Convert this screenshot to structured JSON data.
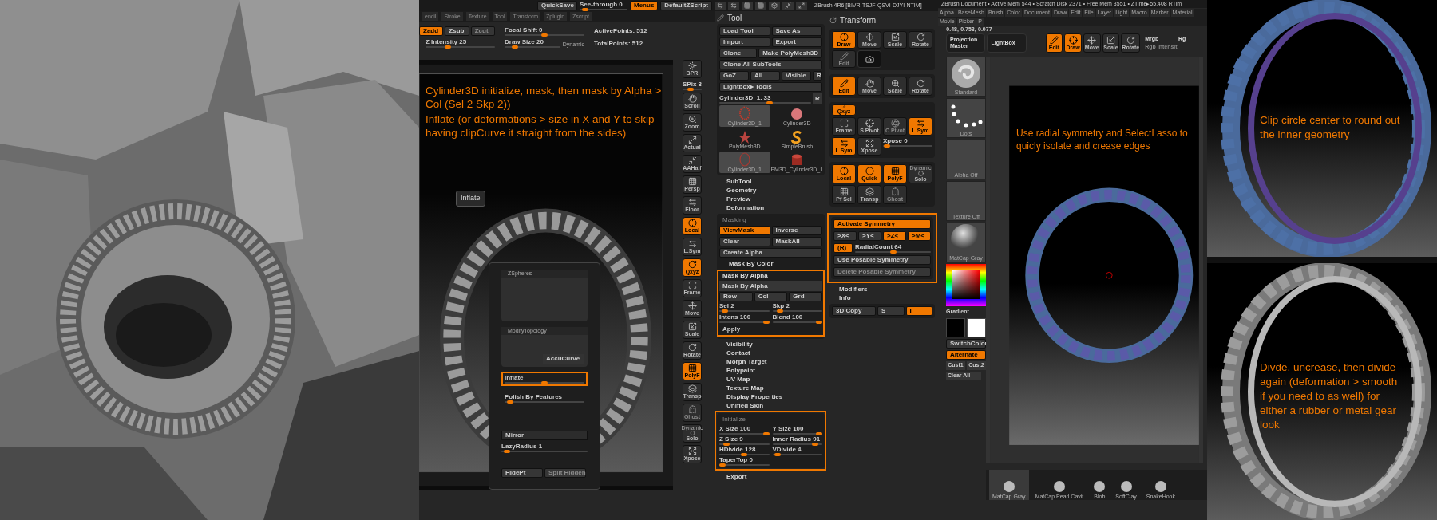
{
  "viewport": {
    "top_buttons": [
      {
        "label": "QuickSave",
        "on": false
      },
      {
        "label": "Menus",
        "on": true
      },
      {
        "label": "DefaultZScript",
        "on": false
      }
    ],
    "see_through": {
      "label": "See-through  0",
      "level": 0.05
    },
    "app_title": "ZBrush 4R6 [BIVR-TSJF-QSVI-DJYI-NTIM]",
    "menu": [
      "encil",
      "Stroke",
      "Texture",
      "Tool",
      "Transform",
      "Zplugin",
      "Zscript"
    ],
    "modes": [
      {
        "label": "Zadd",
        "on": true,
        "disabled": false
      },
      {
        "label": "Zsub",
        "on": false,
        "disabled": false
      },
      {
        "label": "Zcut",
        "on": false,
        "disabled": true
      }
    ],
    "sliders": [
      {
        "label": "Z Intensity 25",
        "level": 0.3
      },
      {
        "label": "Focal Shift 0",
        "level": 0.5
      },
      {
        "label": "Draw Size 20",
        "level": 0.15
      }
    ],
    "dynamic": "Dynamic",
    "stats": [
      "ActivePoints: 512",
      "TotalPoints: 512"
    ],
    "annotation": [
      "Cylinder3D initialize, mask, then mask by Alpha > Col (Sel 2 Skp 2))",
      "Inflate (or deformations  > size in X and Y to skip having clipCurve it straight from the sides)"
    ],
    "popup": {
      "sections": [
        "ZSpheres",
        "ModifyTopology"
      ],
      "accucurve": "AccuCurve",
      "sliders": [
        {
          "label": "Inflate",
          "level": 0.5,
          "highlighted": true
        },
        {
          "label": "Polish By Features",
          "level": 0.03,
          "highlighted": false
        }
      ],
      "mirror": "Mirror",
      "lazy": {
        "label": "LazyRadius 1",
        "level": 0.03
      },
      "buttons": [
        {
          "label": "HidePt",
          "disabled": false
        },
        {
          "label": "Split Hidden",
          "disabled": true
        }
      ]
    },
    "tooltip": "Inflate",
    "shelf": [
      {
        "kind": "button",
        "label": "BPR",
        "on": false,
        "disabled": false
      },
      {
        "kind": "slider",
        "label": "SPix 3",
        "level": 0.4
      },
      {
        "kind": "button",
        "label": "Scroll",
        "on": false,
        "disabled": false
      },
      {
        "kind": "button",
        "label": "Zoom",
        "on": false,
        "disabled": false
      },
      {
        "kind": "button",
        "label": "Actual",
        "on": false,
        "disabled": false
      },
      {
        "kind": "button",
        "label": "AAHalf",
        "on": false,
        "disabled": false
      },
      {
        "kind": "button",
        "label": "Persp",
        "on": false,
        "disabled": false
      },
      {
        "kind": "button",
        "label": "Floor",
        "on": false,
        "disabled": false
      },
      {
        "kind": "button",
        "label": "Local",
        "on": true,
        "disabled": false
      },
      {
        "kind": "button",
        "label": "L.Sym",
        "on": false,
        "disabled": false
      },
      {
        "kind": "button",
        "label": "Qxyz",
        "on": true,
        "disabled": false
      },
      {
        "kind": "button",
        "label": "Frame",
        "on": false,
        "disabled": false
      },
      {
        "kind": "button",
        "label": "Move",
        "on": false,
        "disabled": false
      },
      {
        "kind": "button",
        "label": "Scale",
        "on": false,
        "disabled": false
      },
      {
        "kind": "button",
        "label": "Rotate",
        "on": false,
        "disabled": false
      },
      {
        "kind": "button",
        "label": "PolyF",
        "on": true,
        "disabled": false
      },
      {
        "kind": "button",
        "label": "Transp",
        "on": false,
        "disabled": false
      },
      {
        "kind": "button",
        "label": "Ghost",
        "on": false,
        "disabled": true
      },
      {
        "kind": "button",
        "label": "Solo",
        "caption": "Dynamic",
        "on": false,
        "disabled": false
      },
      {
        "kind": "button",
        "label": "Xpose",
        "on": false,
        "disabled": false
      }
    ]
  },
  "tool_palette": {
    "title": "Tool",
    "rows": [
      [
        {
          "label": "Load Tool",
          "on": false
        },
        {
          "label": "Save As",
          "on": false
        }
      ],
      [
        {
          "label": "Import",
          "on": false
        },
        {
          "label": "Export",
          "on": false
        }
      ],
      [
        {
          "label": "Clone",
          "on": false
        },
        {
          "label": "Make PolyMesh3D",
          "on": false
        }
      ],
      [
        {
          "label": "Clone  All  SubTools",
          "on": false
        }
      ],
      [
        {
          "label": "GoZ",
          "on": false
        },
        {
          "label": "All",
          "on": false
        },
        {
          "label": "Visible",
          "on": false
        },
        {
          "label": "R",
          "on": false
        }
      ],
      [
        {
          "label": "Lightbox▸ Tools",
          "on": false
        }
      ]
    ],
    "current": {
      "label": "Cylinder3D_1. 33",
      "level": 0.55,
      "button": "R"
    },
    "thumbnails": [
      {
        "label": "Cylinder3D_1",
        "selected": true
      },
      {
        "label": "Cylinder3D",
        "selected": false
      },
      {
        "label": "PolyMesh3D",
        "selected": false
      },
      {
        "label": "SimpleBrush",
        "selected": false
      },
      {
        "label": "Cylinder3D_1",
        "selected": true
      },
      {
        "label": "PM3D_Cylinder3D_1",
        "selected": false
      }
    ],
    "sections_top": [
      "SubTool",
      "Geometry",
      "Preview",
      "Deformation"
    ],
    "masking": {
      "title": "Masking",
      "rows": [
        [
          {
            "label": "ViewMask",
            "on": true
          },
          {
            "label": "Inverse",
            "on": false
          }
        ],
        [
          {
            "label": "Clear",
            "on": false
          },
          {
            "label": "MaskAll",
            "on": false
          }
        ],
        [
          {
            "label": "Create Alpha",
            "on": false
          }
        ]
      ],
      "mask_by_color": "Mask By Color",
      "mask_by_alpha": {
        "title": "Mask By Alpha",
        "highlighted": true,
        "button": "Mask By Alpha",
        "modes": [
          {
            "label": "Row",
            "on": false
          },
          {
            "label": "Col",
            "on": false
          },
          {
            "label": "Grd",
            "on": false
          }
        ],
        "sliders": [
          {
            "label": "Sel 2",
            "level": 0.05
          },
          {
            "label": "Skp 2",
            "level": 0.1
          },
          {
            "label": "Intens 100",
            "level": 1
          },
          {
            "label": "Blend 100",
            "level": 1
          }
        ],
        "apply": "Apply"
      }
    },
    "sections_mid": [
      "Visibility",
      "Contact",
      "Morph Target",
      "Polypaint",
      "UV Map",
      "Texture Map",
      "Display Properties",
      "Unified Skin"
    ],
    "initialize": {
      "title": "Initialize",
      "highlighted": true,
      "sliders": [
        {
          "label": "X Size 100",
          "level": 1
        },
        {
          "label": "Y Size 100",
          "level": 1
        },
        {
          "label": "Z Size 9",
          "level": 0.09
        },
        {
          "label": "Inner Radius 91",
          "level": 0.91
        },
        {
          "label": "HDivide 128",
          "level": 0.5
        },
        {
          "label": "VDivide 4",
          "level": 0.05
        },
        {
          "label": "TaperTop 0",
          "level": 0
        }
      ]
    },
    "sections_bottom": [
      "Export"
    ]
  },
  "transform_palette": {
    "title": "Transform",
    "group1": [
      {
        "label": "Draw",
        "on": true,
        "disabled": false
      },
      {
        "label": "Move",
        "on": false,
        "disabled": false
      },
      {
        "label": "Scale",
        "on": false,
        "disabled": false
      },
      {
        "label": "Rotate",
        "on": false,
        "disabled": false
      },
      {
        "label": "Edit",
        "on": false,
        "disabled": true
      }
    ],
    "group2": [
      {
        "label": "Edit",
        "on": true
      },
      {
        "label": "Move",
        "on": false
      },
      {
        "label": "Scale",
        "on": false
      },
      {
        "label": "Rotate",
        "on": false
      }
    ],
    "group3": [
      {
        "label": "Qxyz",
        "on": true,
        "disabled": false
      },
      {
        "label": "Frame",
        "on": false,
        "disabled": false
      },
      {
        "label": "S.Pivot",
        "on": false,
        "disabled": false
      },
      {
        "label": "C.Pivot",
        "on": false,
        "disabled": true
      },
      {
        "label": "L.Sym",
        "on": true,
        "disabled": false
      },
      {
        "label": "L.Sym",
        "on": true,
        "disabled": false
      },
      {
        "label": "Xpose",
        "on": false,
        "disabled": false
      }
    ],
    "xpose": {
      "label": "Xpose 0",
      "level": 0.02
    },
    "group4": [
      {
        "label": "Local",
        "on": true,
        "disabled": false
      },
      {
        "label": "Quick",
        "on": true,
        "disabled": false
      },
      {
        "label": "PolyF",
        "on": true,
        "disabled": false
      },
      {
        "label": "Solo",
        "caption": "Dynamic",
        "on": false,
        "disabled": false
      },
      {
        "label": "Pf Sel",
        "on": false,
        "disabled": false
      },
      {
        "label": "Transp",
        "on": false,
        "disabled": false
      },
      {
        "label": "Ghost",
        "on": false,
        "disabled": true
      }
    ],
    "symmetry": {
      "highlighted": true,
      "activate": {
        "label": "Activate Symmetry",
        "on": true
      },
      "axes": [
        {
          "label": ">X<",
          "on": false
        },
        {
          "label": ">Y<",
          "on": false
        },
        {
          "label": ">Z<",
          "on": true
        },
        {
          "label": ">M<",
          "on": true
        }
      ],
      "radial": {
        "label": "(R)",
        "on": true
      },
      "radial_count": {
        "label": "RadialCount 64",
        "level": 0.5
      },
      "buttons": [
        {
          "label": "Use Posable Symmetry",
          "disabled": false
        },
        {
          "label": "Delete Posable Symmetry",
          "disabled": true
        }
      ]
    },
    "sections": [
      "Modifiers",
      "Info"
    ],
    "copy_row": [
      {
        "label": "3D Copy",
        "on": false
      },
      {
        "label": "S",
        "on": false
      },
      {
        "label": "I",
        "on": true
      }
    ]
  },
  "document": {
    "title": "ZBrush Document  • Active Mem 544 • Scratch Disk 2371 • Free Mem 3551 • ZTime▸55.408 RTim",
    "menu": [
      "Alpha",
      "BaseMesh",
      "Brush",
      "Color",
      "Document",
      "Draw",
      "Edit",
      "File",
      "Layer",
      "Light",
      "Macro",
      "Marker",
      "Material",
      "Movie",
      "Picker",
      "P"
    ],
    "coords": "-0.48,-0.758,-0.077",
    "top_buttons": [
      "Projection Master",
      "LightBox"
    ],
    "transform": [
      {
        "label": "Edit",
        "on": true
      },
      {
        "label": "Draw",
        "on": true
      },
      {
        "label": "Move",
        "on": false
      },
      {
        "label": "Scale",
        "on": false
      },
      {
        "label": "Rotate",
        "on": false
      }
    ],
    "color_modes": [
      {
        "label": "Mrgb",
        "disabled": false
      },
      {
        "label": "Rg",
        "disabled": false
      },
      {
        "label": "Rgb Intensit",
        "disabled": true
      }
    ],
    "shelf": [
      "Standard",
      "Dots",
      "Alpha Off",
      "Texture Off",
      "MatCap Gray"
    ],
    "gradient": "Gradient",
    "color_buttons": [
      {
        "label": "SwitchColor",
        "on": false
      },
      {
        "label": "Alternate",
        "on": true
      }
    ],
    "custom": [
      "Cust1",
      "Cust2"
    ],
    "clear": "Clear All",
    "annotation": "Use radial symmetry and SelectLasso to quicly isolate and crease edges",
    "materials": [
      {
        "label": "MatCap Gray",
        "selected": true
      },
      {
        "label": "MatCap Pearl Cavit",
        "selected": false
      },
      {
        "label": "Blob",
        "selected": false
      },
      {
        "label": "SoftClay",
        "selected": false
      },
      {
        "label": "SnakeHook",
        "selected": false
      }
    ]
  },
  "notes": [
    "Clip circle center to round out the inner geometry",
    "Divde, uncrease, then divide again (deformation > smooth if you need to as well) for either a rubber or metal gear look"
  ]
}
